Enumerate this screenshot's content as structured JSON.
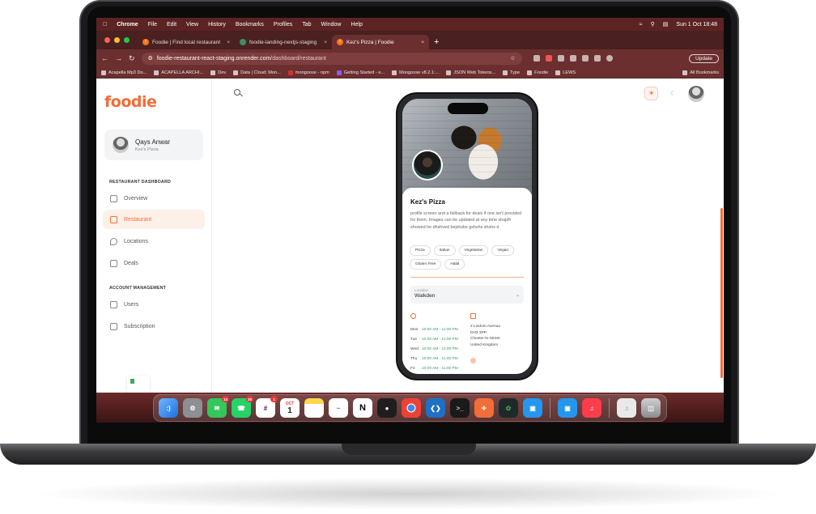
{
  "menubar": {
    "app": "Chrome",
    "items": [
      "File",
      "Edit",
      "View",
      "History",
      "Bookmarks",
      "Profiles",
      "Tab",
      "Window",
      "Help"
    ],
    "clock": "Sun 1 Oct  18:48"
  },
  "tabs": [
    {
      "title": "Foodie | Find local restaurant",
      "active": false
    },
    {
      "title": "foodie-landing-nextjs-staging",
      "active": false
    },
    {
      "title": "Kez's Pizza | Foodie",
      "active": true
    }
  ],
  "omnibox": {
    "host": "foodie-restaurant-react-staging.onrender.com",
    "path": "/dashboard/restaurant"
  },
  "update_label": "Update",
  "bookmarks": [
    "Acapella Mp3 Do...",
    "ACAPELLA ARCHI...",
    "Dev",
    "Data | Cloud: Mon...",
    "mongoose - npm",
    "Getting Started - e...",
    "Mongoose v8.2.1:...",
    "JSON Web Tokens...",
    "Type",
    "Foodie",
    "LEWS"
  ],
  "all_bookmarks": "All Bookmarks",
  "sidebar": {
    "logo": "foodie",
    "user": {
      "name": "Qays Anwar",
      "restaurant": "Kez's Pizza"
    },
    "section1": "RESTAURANT DASHBOARD",
    "section1_items": [
      {
        "label": "Overview",
        "active": false
      },
      {
        "label": "Restaurant",
        "active": true
      },
      {
        "label": "Locations",
        "active": false
      },
      {
        "label": "Deals",
        "active": false
      }
    ],
    "section2": "ACCOUNT MANAGEMENT",
    "section2_items": [
      {
        "label": "Users"
      },
      {
        "label": "Subscription"
      }
    ]
  },
  "preview": {
    "name": "Kez's Pizza",
    "description": "profile screen and a fallback for deals if one isn't provided for them. Images can be updated at any time shajdh showed he dhshved bejshsbs gshshs shshs d",
    "tags": [
      "Pizza",
      "Italian",
      "Vegetarian",
      "Vegan",
      "Gluten Free",
      "Halal"
    ],
    "location_label": "Location",
    "location_value": "Walkden",
    "hours": [
      {
        "day": "Mon",
        "time": "10:00 AM - 11:00 PM"
      },
      {
        "day": "Tue",
        "time": "10:00 AM - 11:00 PM"
      },
      {
        "day": "Wed",
        "time": "10:00 AM - 11:00 PM"
      },
      {
        "day": "Thu",
        "time": "10:00 AM - 11:00 PM"
      },
      {
        "day": "Fri",
        "time": "10:00 AM - 11:00 PM"
      }
    ],
    "address": [
      "2 Lindom Avenue",
      "DH3 3PP",
      "Chester-le-Street",
      "United Kingdom"
    ]
  },
  "dock": {
    "badges": {
      "messages": "14",
      "whatsapp": "26",
      "slack": "1"
    },
    "calendar_month": "OCT",
    "calendar_day": "1"
  },
  "colors": {
    "accent": "#f26d38",
    "titlebar": "#5c2323",
    "hours_green": "#2e9e63"
  }
}
